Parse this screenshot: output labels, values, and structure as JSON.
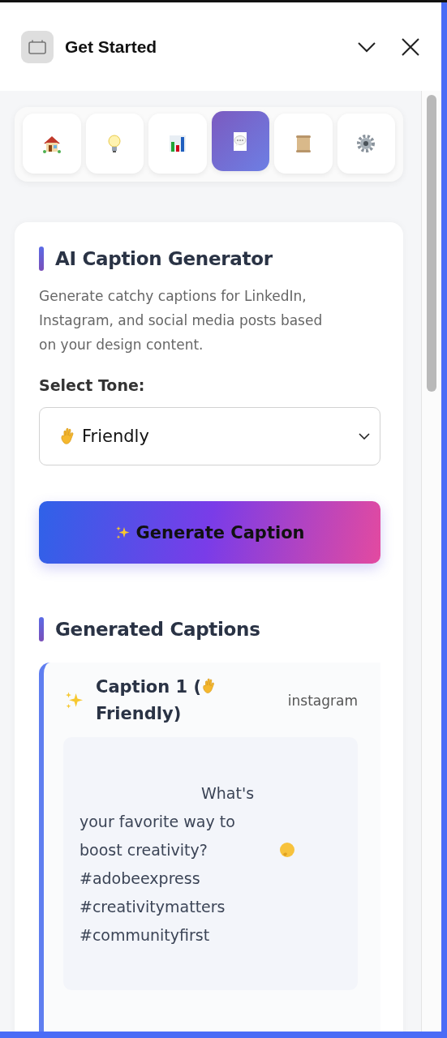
{
  "header": {
    "title": "Get Started"
  },
  "tabs": [
    {
      "kind": "house",
      "selected": false
    },
    {
      "kind": "bulb",
      "selected": false
    },
    {
      "kind": "chart",
      "selected": false
    },
    {
      "kind": "speech",
      "selected": true
    },
    {
      "kind": "scroll",
      "selected": false
    },
    {
      "kind": "gear",
      "selected": false
    }
  ],
  "generator": {
    "title": "AI Caption Generator",
    "description": "Generate catchy captions for LinkedIn, Instagram, and social media posts based on your design content.",
    "tone_label": "Select Tone:",
    "tone_value": "Friendly",
    "button": "Generate Caption"
  },
  "results": {
    "title": "Generated Captions",
    "captions": [
      {
        "title_start": "Caption 1 (",
        "title_end": "Friendly)",
        "platform": "instagram",
        "text": "What's your favorite way to boost creativity?",
        "hashtags": [
          "#adobeexpress",
          "#creativitymatters",
          "#communityfirst"
        ]
      }
    ]
  }
}
